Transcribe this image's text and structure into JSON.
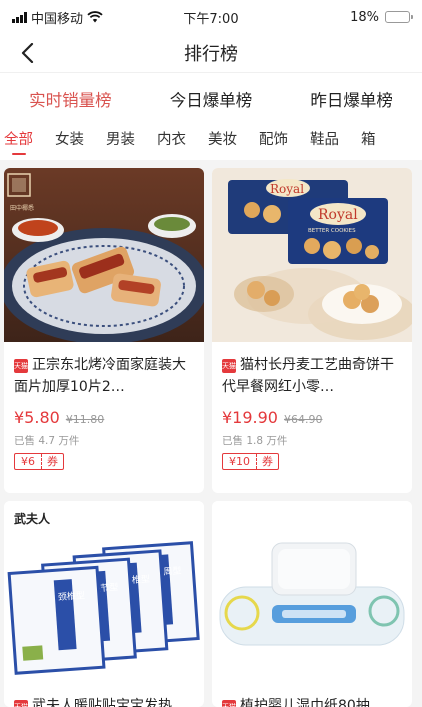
{
  "status_bar": {
    "carrier": "中国移动",
    "time": "下午7:00",
    "battery": "18%",
    "battery_level": 0.18
  },
  "nav": {
    "title": "排行榜"
  },
  "rank_tabs": [
    {
      "label": "实时销量榜",
      "active": true
    },
    {
      "label": "今日爆单榜",
      "active": false
    },
    {
      "label": "昨日爆单榜",
      "active": false
    }
  ],
  "category_tabs": [
    "全部",
    "女装",
    "男装",
    "内衣",
    "美妆",
    "配饰",
    "鞋品",
    "箱"
  ],
  "products": [
    {
      "title": "正宗东北烤冷面家庭装大面片加厚10片2…",
      "price": "¥5.80",
      "original_price": "¥11.80",
      "sold": "已售 4.7 万件",
      "coupon_amount": "¥6",
      "coupon_label": "券",
      "brand_logo": "田中椰悉",
      "badge": "天猫"
    },
    {
      "title": "猫村长丹麦工艺曲奇饼干代早餐网红小零…",
      "price": "¥19.90",
      "original_price": "¥64.90",
      "sold": "已售 1.8 万件",
      "coupon_amount": "¥10",
      "coupon_label": "券",
      "brand_logo": "Royal",
      "brand_sub": "BETTER COOKIES",
      "badge": "天猫"
    },
    {
      "title": "武夫人暖贴贴宝宝发热",
      "brand_logo": "武夫人",
      "box_labels": [
        "颈椎型",
        "关节型",
        "腰椎型",
        "肩周型"
      ],
      "badge": "天猫"
    },
    {
      "title": "植护婴儿湿巾纸80抽",
      "badge": "天猫"
    }
  ],
  "colors": {
    "accent": "#e4393c",
    "active_tab": "#d9534f"
  }
}
